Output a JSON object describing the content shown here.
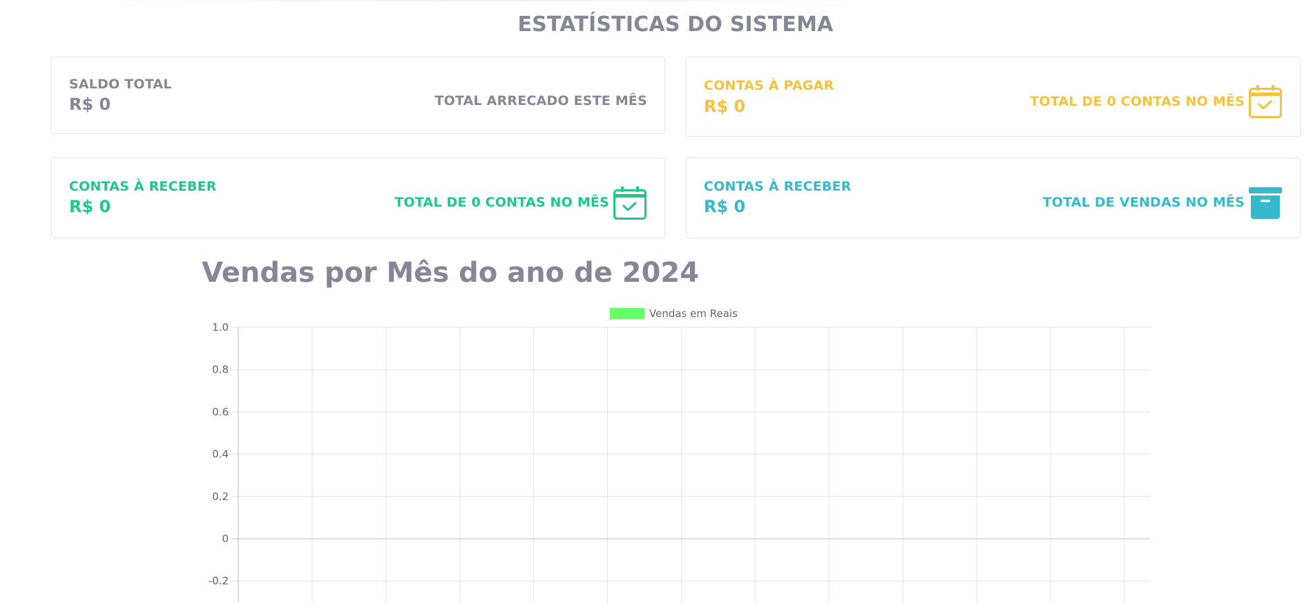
{
  "page": {
    "heading": "ESTATÍSTICAS DO SISTEMA"
  },
  "cards": {
    "saldo": {
      "label": "SALDO TOTAL",
      "value": "R$ 0",
      "note": "TOTAL ARRECADO ESTE MÊS",
      "color": "#858796"
    },
    "pagar": {
      "label": "CONTAS À PAGAR",
      "value": "R$ 0",
      "note": "TOTAL DE 0 CONTAS NO MÊS",
      "icon": "calendar-check-icon",
      "color": "#f6c23e"
    },
    "receber": {
      "label": "CONTAS À RECEBER",
      "value": "R$ 0",
      "note": "TOTAL DE 0 CONTAS NO MÊS",
      "icon": "calendar-check-icon",
      "color": "#1cc88a"
    },
    "vendas": {
      "label": "CONTAS À RECEBER",
      "value": "R$ 0",
      "note": "TOTAL DE VENDAS NO MÊS",
      "icon": "archive-box-icon",
      "color": "#36b9cc"
    }
  },
  "chart_title": "Vendas por Mês do ano de 2024",
  "chart_data": {
    "type": "bar",
    "title": "Vendas por Mês do ano de 2024",
    "xlabel": "",
    "ylabel": "",
    "categories": [],
    "series": [
      {
        "name": "Vendas em Reais",
        "values": [],
        "color": "#66ff66"
      }
    ],
    "yticks": [
      "1.0",
      "0.8",
      "0.6",
      "0.4",
      "0.2",
      "0",
      "-0.2"
    ],
    "ylim": [
      -0.2,
      1.0
    ],
    "grid": true,
    "legend": "top-center"
  }
}
